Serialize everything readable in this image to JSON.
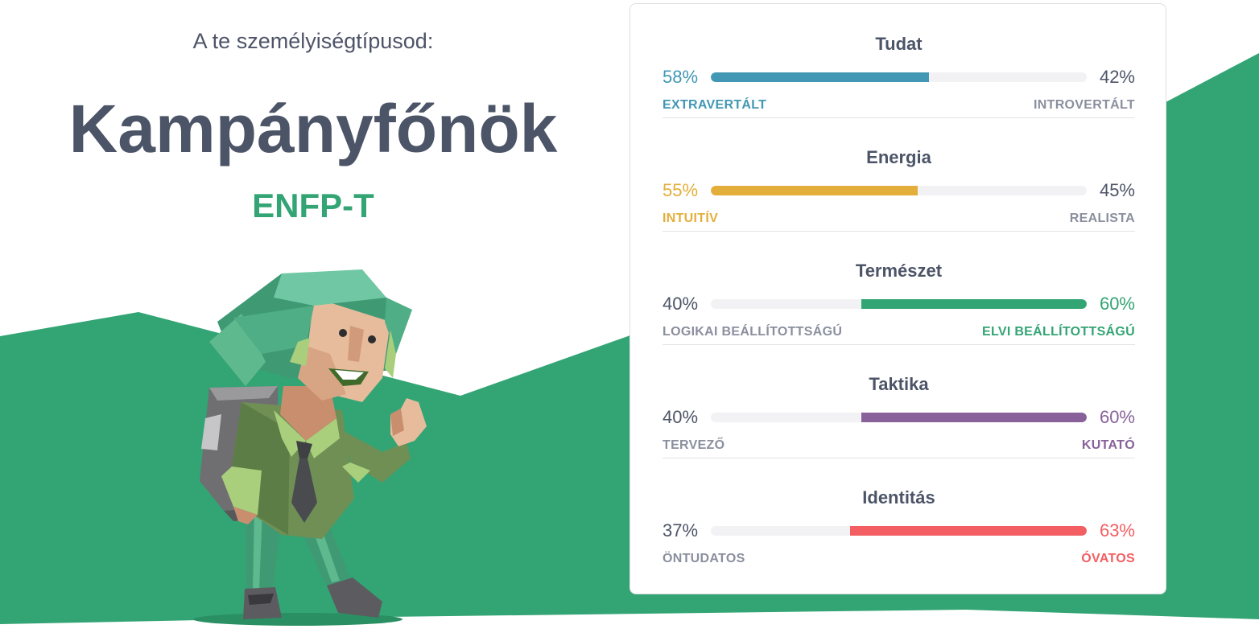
{
  "header": {
    "intro": "A te személyiségtípusod:",
    "type_name": "Kampányfőnök",
    "type_code": "ENFP-T"
  },
  "colors": {
    "green": "#33a474",
    "blue": "#4298b4",
    "yellow": "#e4ae3a",
    "purple": "#88619a",
    "red": "#f25e62",
    "text": "#4c5467"
  },
  "traits": [
    {
      "title": "Tudat",
      "left_pct": "58%",
      "right_pct": "42%",
      "left_label": "EXTRAVERTÁLT",
      "right_label": "INTROVERTÁLT",
      "dominant": "left",
      "value": 58,
      "color": "#4298b4"
    },
    {
      "title": "Energia",
      "left_pct": "55%",
      "right_pct": "45%",
      "left_label": "INTUITÍV",
      "right_label": "REALISTA",
      "dominant": "left",
      "value": 55,
      "color": "#e4ae3a"
    },
    {
      "title": "Természet",
      "left_pct": "40%",
      "right_pct": "60%",
      "left_label": "LOGIKAI BEÁLLÍTOTTSÁGÚ",
      "right_label": "ELVI BEÁLLÍTOTTSÁGÚ",
      "dominant": "right",
      "value": 60,
      "color": "#33a474"
    },
    {
      "title": "Taktika",
      "left_pct": "40%",
      "right_pct": "60%",
      "left_label": "TERVEZŐ",
      "right_label": "KUTATÓ",
      "dominant": "right",
      "value": 60,
      "color": "#88619a"
    },
    {
      "title": "Identitás",
      "left_pct": "37%",
      "right_pct": "63%",
      "left_label": "ÖNTUDATOS",
      "right_label": "ÓVATOS",
      "dominant": "right",
      "value": 63,
      "color": "#f25e62"
    }
  ]
}
